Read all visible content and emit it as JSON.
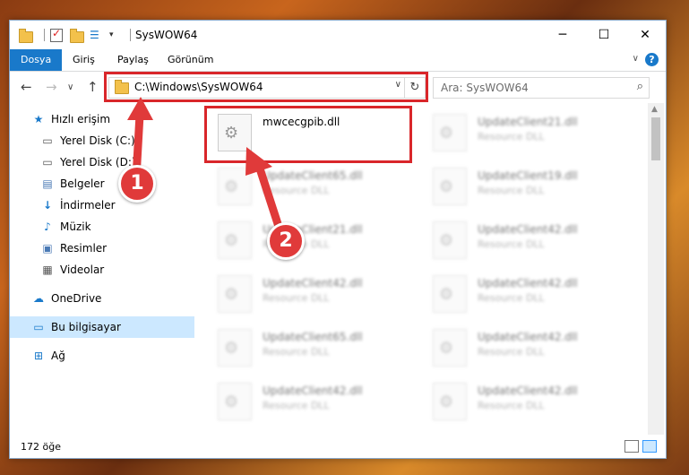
{
  "window": {
    "title": "SysWOW64"
  },
  "ribbon": {
    "tabs": [
      "Dosya",
      "Giriş",
      "Paylaş",
      "Görünüm"
    ],
    "help": "?"
  },
  "navbar": {
    "address": "C:\\Windows\\SysWOW64",
    "search_placeholder": "Ara: SysWOW64"
  },
  "sidebar": {
    "items": [
      {
        "label": "Hızlı erişim"
      },
      {
        "label": "Yerel Disk (C:)"
      },
      {
        "label": "Yerel Disk (D:)"
      },
      {
        "label": "Belgeler"
      },
      {
        "label": "İndirmeler"
      },
      {
        "label": "Müzik"
      },
      {
        "label": "Resimler"
      },
      {
        "label": "Videolar"
      },
      {
        "label": "OneDrive"
      },
      {
        "label": "Bu bilgisayar"
      },
      {
        "label": "Ağ"
      }
    ]
  },
  "files": [
    {
      "name": "mwcecgpib.dll",
      "type": ""
    },
    {
      "name": "UpdateClient21.dll",
      "type": "Resource DLL"
    },
    {
      "name": "UpdateClient65.dll",
      "type": "Resource DLL"
    },
    {
      "name": "UpdateClient19.dll",
      "type": "Resource DLL"
    },
    {
      "name": "UpdateClient21.dll",
      "type": "Resource DLL"
    },
    {
      "name": "UpdateClient42.dll",
      "type": "Resource DLL"
    },
    {
      "name": "UpdateClient42.dll",
      "type": "Resource DLL"
    },
    {
      "name": "UpdateClient42.dll",
      "type": "Resource DLL"
    },
    {
      "name": "UpdateClient65.dll",
      "type": "Resource DLL"
    },
    {
      "name": "UpdateClient42.dll",
      "type": "Resource DLL"
    },
    {
      "name": "UpdateClient42.dll",
      "type": "Resource DLL"
    },
    {
      "name": "UpdateClient42.dll",
      "type": "Resource DLL"
    }
  ],
  "status": {
    "count": "172 öğe"
  },
  "callouts": {
    "one": "1",
    "two": "2"
  },
  "colors": {
    "accent": "#1979ca",
    "highlight": "#d9262a",
    "selection": "#cce8ff"
  }
}
